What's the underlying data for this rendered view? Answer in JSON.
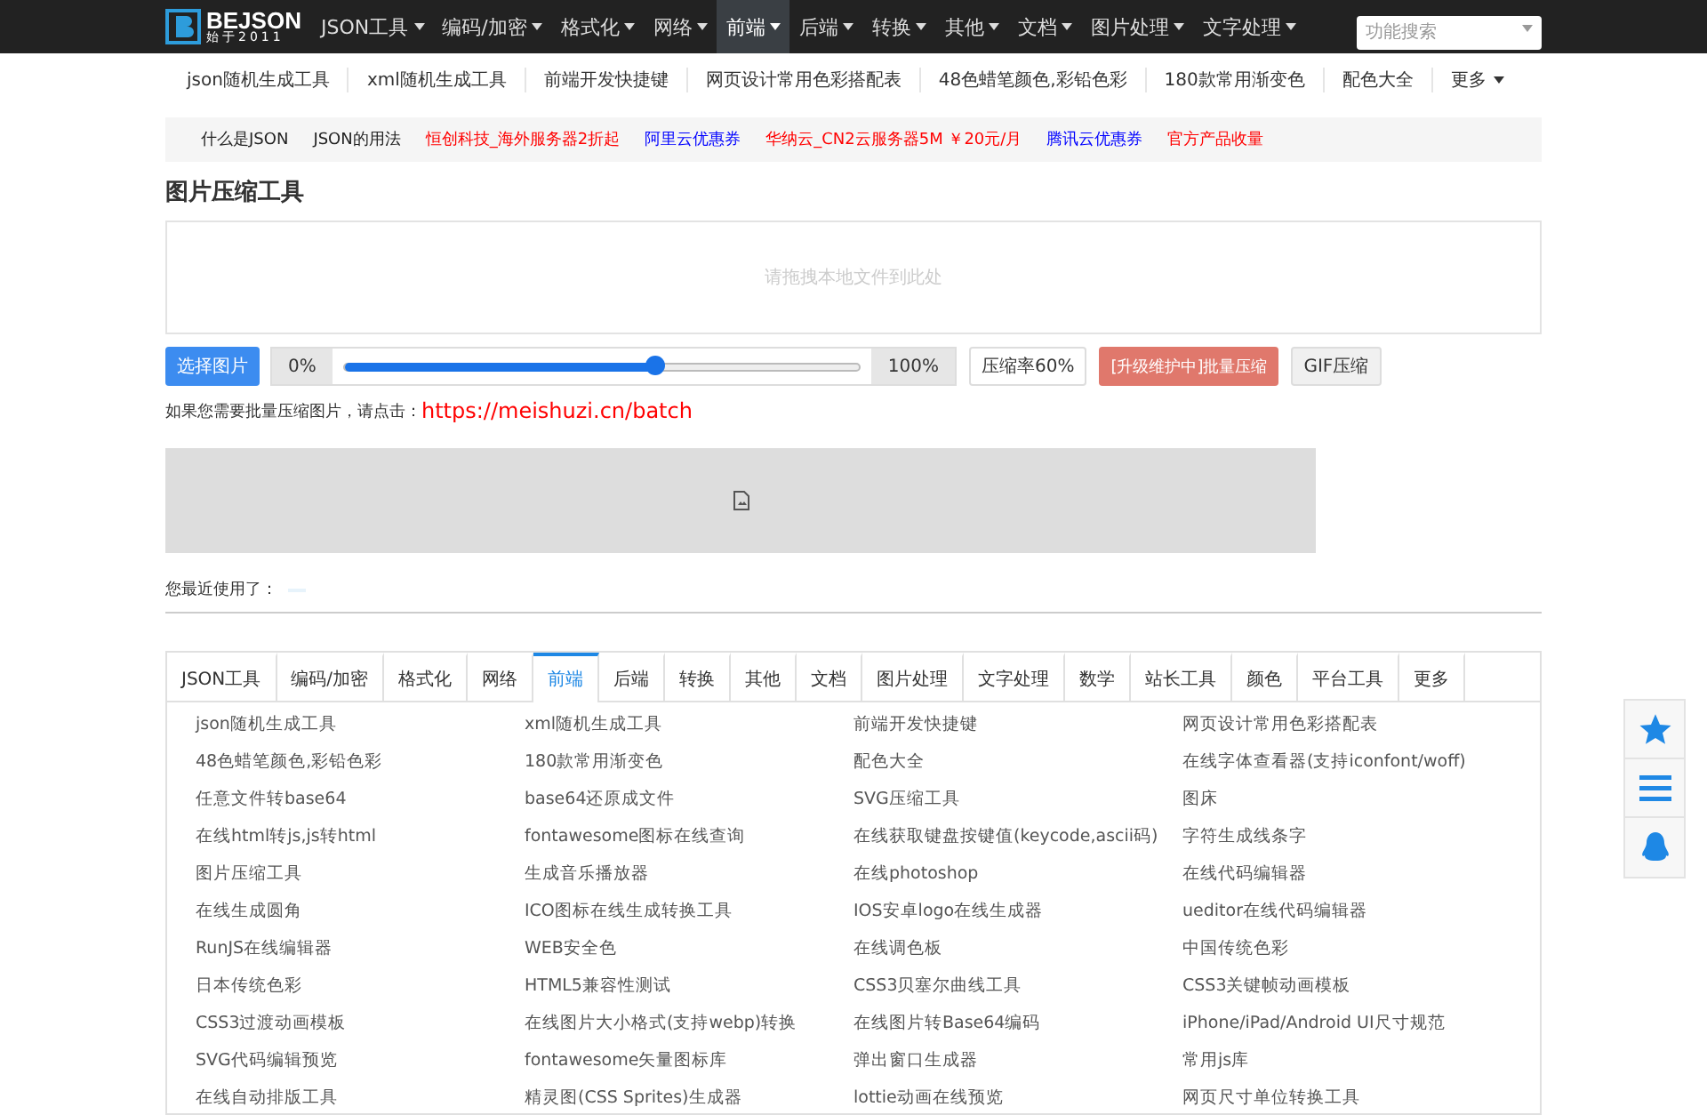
{
  "logo": {
    "name": "BEJSON",
    "tagline": "始于2011"
  },
  "nav": [
    {
      "label": "JSON工具",
      "selected": false
    },
    {
      "label": "编码/加密",
      "selected": false
    },
    {
      "label": "格式化",
      "selected": false
    },
    {
      "label": "网络",
      "selected": false
    },
    {
      "label": "前端",
      "selected": true
    },
    {
      "label": "后端",
      "selected": false
    },
    {
      "label": "转换",
      "selected": false
    },
    {
      "label": "其他",
      "selected": false
    },
    {
      "label": "文档",
      "selected": false
    },
    {
      "label": "图片处理",
      "selected": false
    },
    {
      "label": "文字处理",
      "selected": false
    }
  ],
  "search": {
    "placeholder": "功能搜索"
  },
  "subnav": [
    "json随机生成工具",
    "xml随机生成工具",
    "前端开发快捷键",
    "网页设计常用色彩搭配表",
    "48色蜡笔颜色,彩铅色彩",
    "180款常用渐变色",
    "配色大全"
  ],
  "subnav_more": "更多",
  "ads": [
    {
      "label": "什么是JSON",
      "color": "#222222"
    },
    {
      "label": "JSON的用法",
      "color": "#222222"
    },
    {
      "label": "恒创科技_海外服务器2折起",
      "color": "#ff0000"
    },
    {
      "label": "阿里云优惠券",
      "color": "#0000ff"
    },
    {
      "label": "华纳云_CN2云服务器5M ￥20元/月",
      "color": "#ff0000"
    },
    {
      "label": "腾讯云优惠券",
      "color": "#0000ff"
    },
    {
      "label": "官方产品收量",
      "color": "#ff0000"
    }
  ],
  "tool": {
    "title": "图片压缩工具",
    "drop_hint": "请拖拽本地文件到此处",
    "choose": "选择图片",
    "min": "0%",
    "max": "100%",
    "level": 0.6,
    "rate": "压缩率60%",
    "batch": {
      "label": "[升级维护中]批量压缩",
      "disabled": true
    },
    "gif": "GIF压缩",
    "batch_note": "如果您需要批量压缩图片，请点击：",
    "batch_link": "https://meishuzi.cn/batch",
    "recent": "您最近使用了："
  },
  "tabs": [
    {
      "label": "JSON工具",
      "selected": false
    },
    {
      "label": "编码/加密",
      "selected": false
    },
    {
      "label": "格式化",
      "selected": false
    },
    {
      "label": "网络",
      "selected": false
    },
    {
      "label": "前端",
      "selected": true
    },
    {
      "label": "后端",
      "selected": false
    },
    {
      "label": "转换",
      "selected": false
    },
    {
      "label": "其他",
      "selected": false
    },
    {
      "label": "文档",
      "selected": false
    },
    {
      "label": "图片处理",
      "selected": false
    },
    {
      "label": "文字处理",
      "selected": false
    },
    {
      "label": "数学",
      "selected": false
    },
    {
      "label": "站长工具",
      "selected": false
    },
    {
      "label": "颜色",
      "selected": false
    },
    {
      "label": "平台工具",
      "selected": false
    },
    {
      "label": "更多",
      "selected": false
    }
  ],
  "links": [
    "json随机生成工具",
    "xml随机生成工具",
    "前端开发快捷键",
    "网页设计常用色彩搭配表",
    "48色蜡笔颜色,彩铅色彩",
    "180款常用渐变色",
    "配色大全",
    "在线字体查看器(支持iconfont/woff)",
    "任意文件转base64",
    "base64还原成文件",
    "SVG压缩工具",
    "图床",
    "在线html转js,js转html",
    "fontawesome图标在线查询",
    "在线获取键盘按键值(keycode,ascii码)",
    "字符生成线条字",
    "图片压缩工具",
    "生成音乐播放器",
    "在线photoshop",
    "在线代码编辑器",
    "在线生成圆角",
    "ICO图标在线生成转换工具",
    "IOS安卓logo在线生成器",
    "ueditor在线代码编辑器",
    "RunJS在线编辑器",
    "WEB安全色",
    "在线调色板",
    "中国传统色彩",
    "日本传统色彩",
    "HTML5兼容性测试",
    "CSS3贝塞尔曲线工具",
    "CSS3关键帧动画模板",
    "CSS3过渡动画模板",
    "在线图片大小格式(支持webp)转换",
    "在线图片转Base64编码",
    "iPhone/iPad/Android UI尺寸规范",
    "SVG代码编辑预览",
    "fontawesome矢量图标库",
    "弹出窗口生成器",
    "常用js库",
    "在线自动排版工具",
    "精灵图(CSS Sprites)生成器",
    "lottie动画在线预览",
    "网页尺寸单位转换工具"
  ]
}
